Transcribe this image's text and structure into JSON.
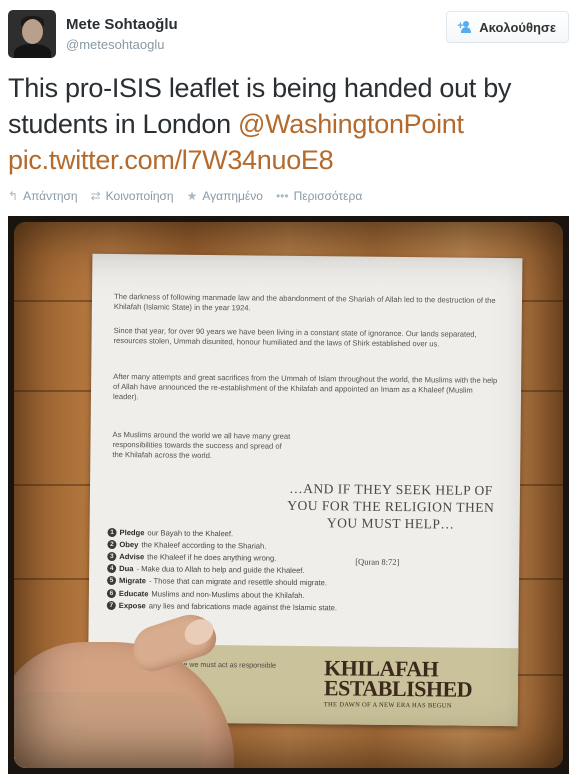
{
  "author": {
    "name": "Mete Sohtaoğlu",
    "handle": "@metesohtaoglu"
  },
  "follow_button": {
    "label": "Ακολούθησε",
    "icon": "follow-user-icon"
  },
  "tweet": {
    "text_part1": "This pro-ISIS leaflet is being handed out by students in London ",
    "mention": "@WashingtonPoint",
    "link": "pic.twitter.com/l7W34nuoE8"
  },
  "actions": {
    "reply": "Απάντηση",
    "retweet": "Κοινοποίηση",
    "favorite": "Αγαπημένο",
    "more": "Περισσότερα"
  },
  "leaflet": {
    "para1": "The darkness of following manmade law and the abandonment of the Shariah of Allah led to the destruction of the Khilafah (Islamic State) in the year 1924.",
    "para2": "Since that year, for over 90 years we have been living in a constant state of ignorance. Our lands separated, resources stolen, Ummah disunited, honour humiliated and the laws of Shirk established over us.",
    "para3": "After many attempts and great sacrifices from the Ummah of Islam throughout the world, the Muslims with the help of Allah have announced the re-establishment of the Khilafah and appointed an Imam as a Khaleef (Muslim leader).",
    "para4": "As Muslims around the world we all have many great responsibilities towards the success and spread of the Khilafah across the world.",
    "quote": "…AND IF THEY SEEK HELP OF YOU FOR THE RELIGION THEN YOU MUST HELP…",
    "quote_ref": "[Quran 8:72]",
    "steps": [
      {
        "n": "1",
        "bold": "Pledge",
        "rest": "our Bayah to the Khaleef."
      },
      {
        "n": "2",
        "bold": "Obey",
        "rest": "the Khaleef according to the Shariah."
      },
      {
        "n": "3",
        "bold": "Advise",
        "rest": "the Khaleef if he does anything wrong."
      },
      {
        "n": "4",
        "bold": "Dua",
        "rest": "- Make dua to Allah to help and guide the Khaleef."
      },
      {
        "n": "5",
        "bold": "Migrate",
        "rest": "- Those that can migrate and resettle should migrate."
      },
      {
        "n": "6",
        "bold": "Educate",
        "rest": "Muslims and non-Muslims about the Khilafah."
      },
      {
        "n": "7",
        "bold": "Expose",
        "rest": "any lies and fabrications made against the Islamic state."
      }
    ],
    "band_text": "nt of the Khilafah. Like the we must act as responsible showing love, concern and",
    "brand_line1": "KHILAFAH",
    "brand_line2": "ESTABLISHED",
    "brand_tagline": "THE DAWN OF A NEW ERA HAS BEGUN"
  }
}
